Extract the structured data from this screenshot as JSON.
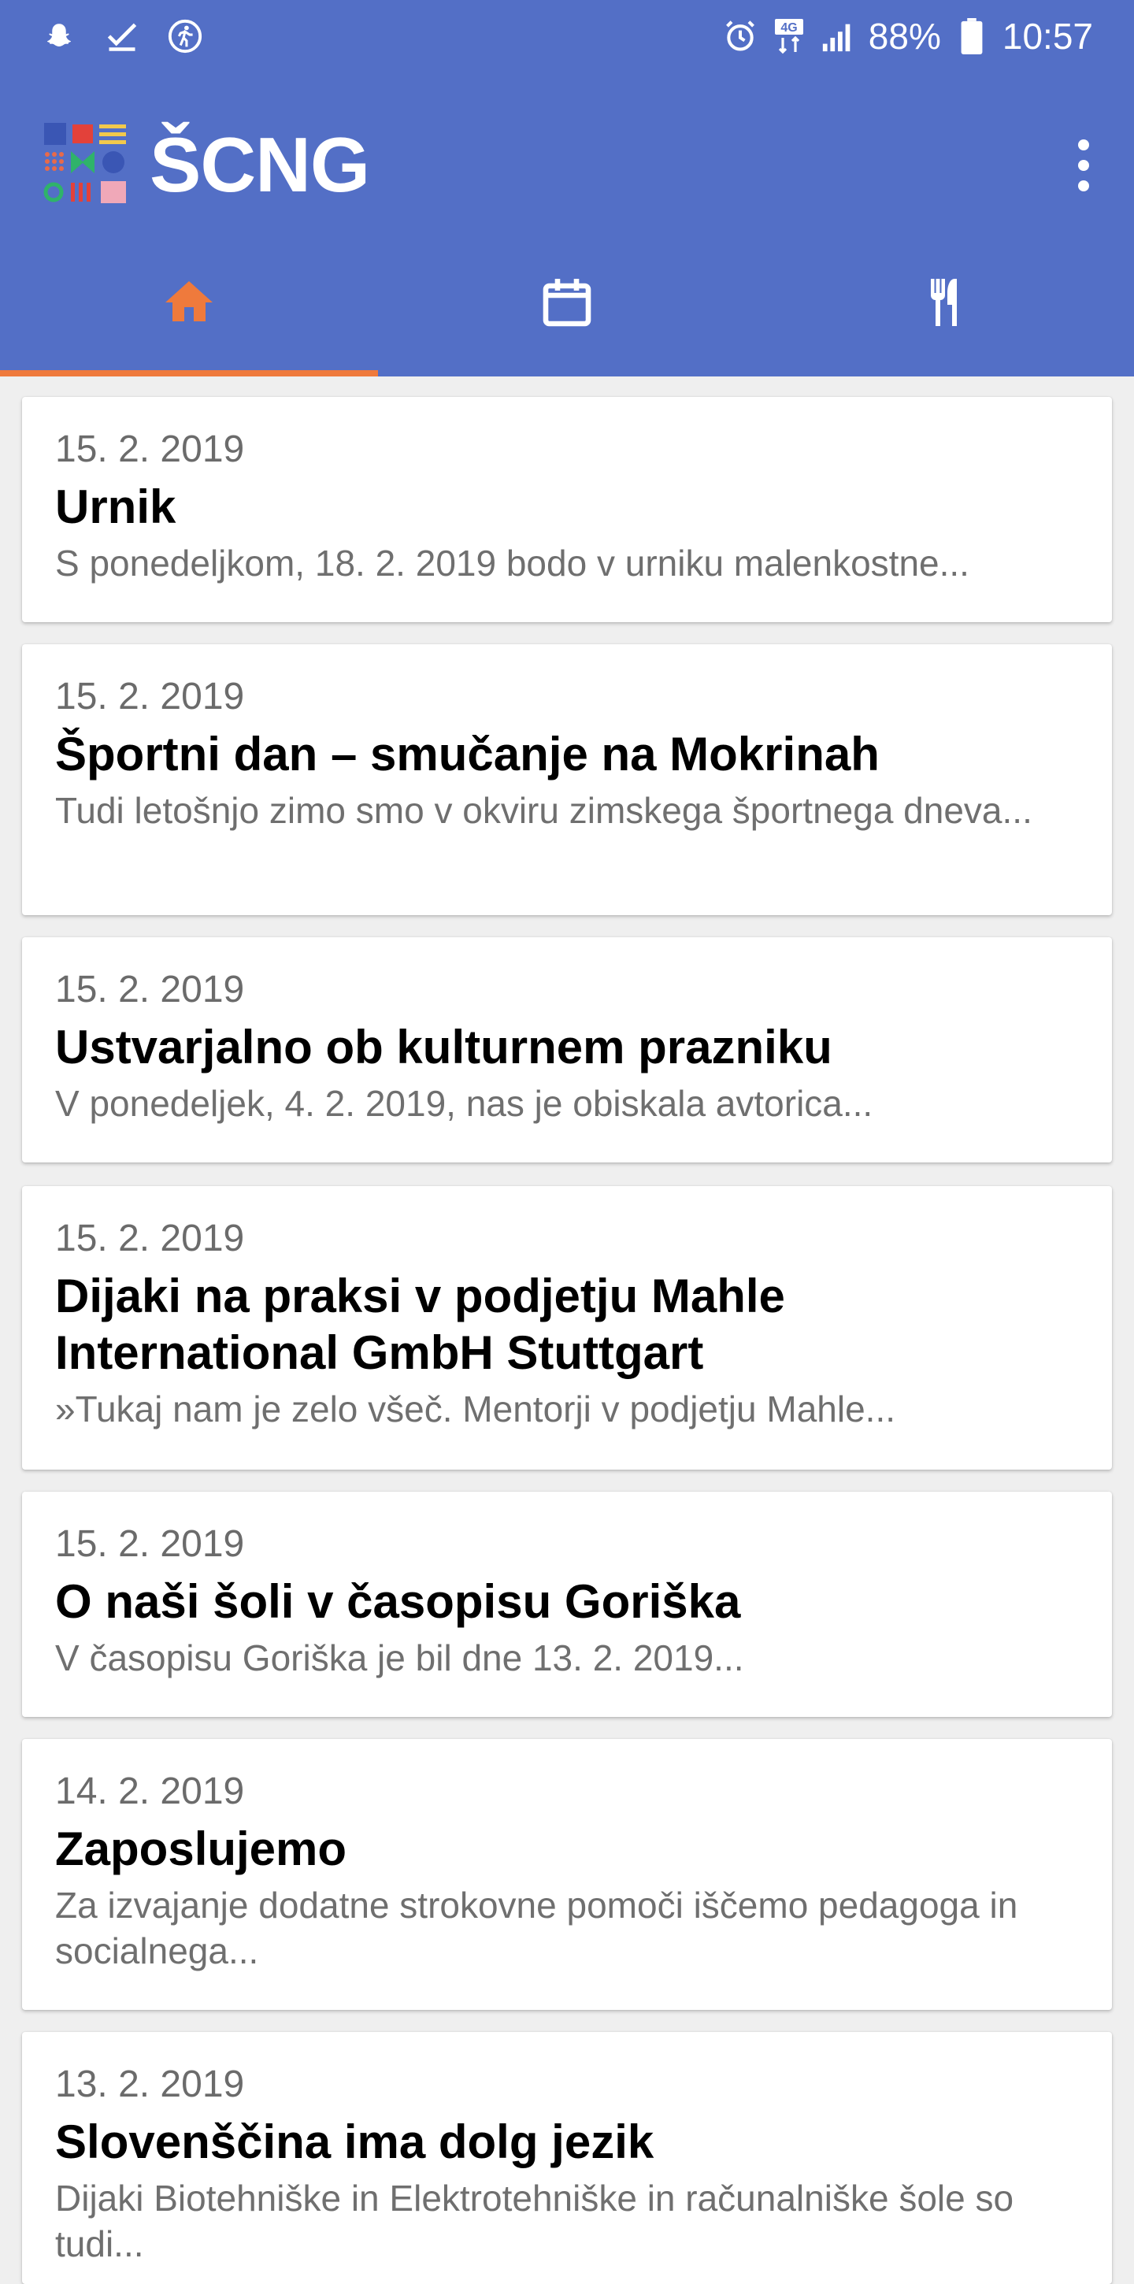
{
  "status_bar": {
    "battery": "88%",
    "time": "10:57",
    "network": "4G",
    "left_icons": [
      "snapchat-icon",
      "checkmark-icon",
      "activity-icon"
    ],
    "right_icons": [
      "alarm-icon",
      "network-4g-icon",
      "signal-icon",
      "battery-icon"
    ]
  },
  "app": {
    "title": "ŠCNG",
    "brand_color": "#536fc6",
    "accent_color": "#ef7a3c"
  },
  "tabs": [
    {
      "icon": "home-icon",
      "selected": true
    },
    {
      "icon": "calendar-icon",
      "selected": false
    },
    {
      "icon": "cutlery-icon",
      "selected": false
    }
  ],
  "news": [
    {
      "date": "15. 2. 2019",
      "title": "Urnik",
      "excerpt": "S ponedeljkom, 18. 2. 2019 bodo v urniku malenkostne..."
    },
    {
      "date": "15. 2. 2019",
      "title": "Športni dan – smučanje na Mokrinah",
      "excerpt": "Tudi letošnjo zimo smo v okviru zimskega športnega dneva..."
    },
    {
      "date": "15. 2. 2019",
      "title": "Ustvarjalno ob kulturnem prazniku",
      "excerpt": "V ponedeljek, 4. 2. 2019, nas je obiskala avtorica..."
    },
    {
      "date": "15. 2. 2019",
      "title": "Dijaki na praksi v podjetju Mahle International GmbH Stuttgart",
      "excerpt": "»Tukaj nam je zelo všeč. Mentorji v podjetju Mahle..."
    },
    {
      "date": "15. 2. 2019",
      "title": "O naši šoli v časopisu Goriška",
      "excerpt": "V časopisu Goriška je bil dne 13. 2. 2019..."
    },
    {
      "date": "14. 2. 2019",
      "title": "Zaposlujemo",
      "excerpt": "Za izvajanje dodatne strokovne pomoči iščemo pedagoga in socialnega..."
    },
    {
      "date": "13. 2. 2019",
      "title": "Slovenščina ima dolg jezik",
      "excerpt": "Dijaki Biotehniške in Elektrotehniške in računalniške šole so tudi..."
    }
  ]
}
